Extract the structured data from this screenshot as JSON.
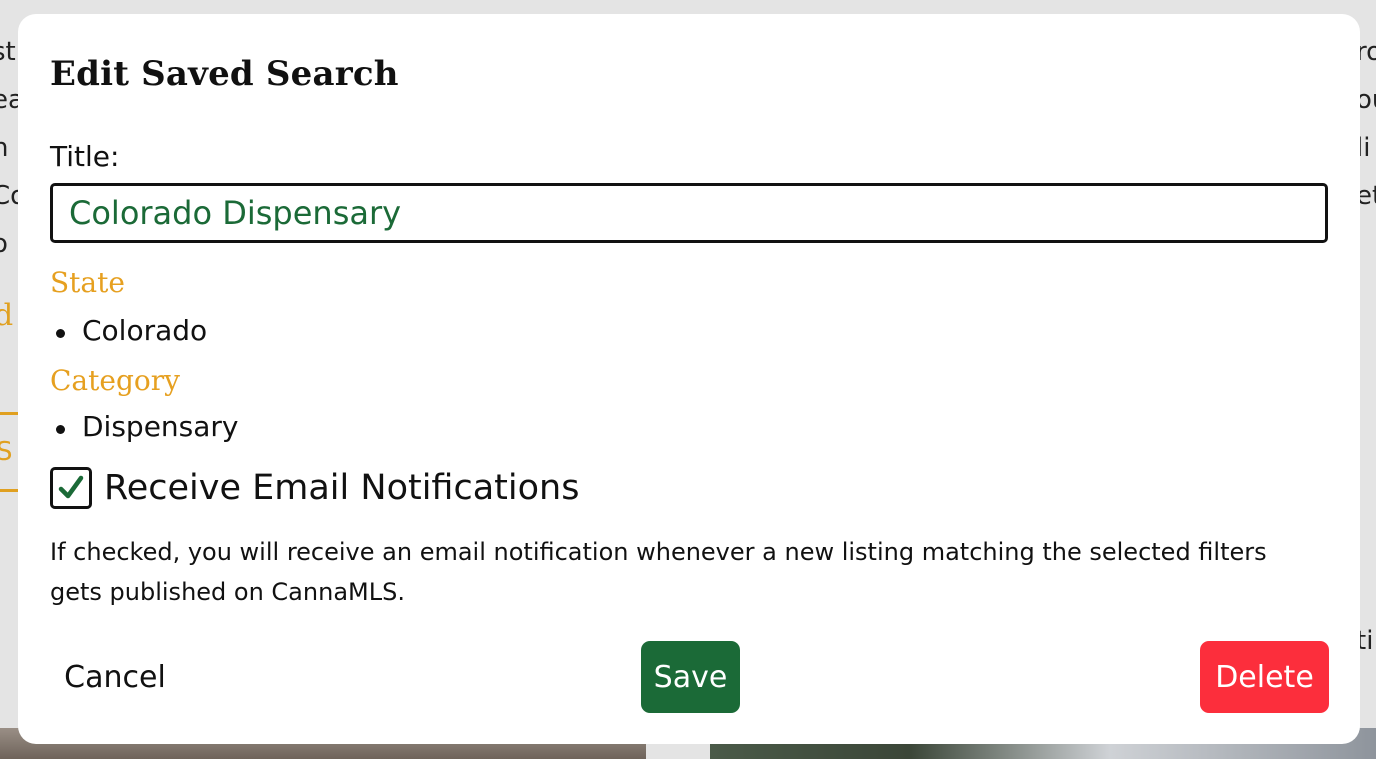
{
  "background": {
    "left_fragments": [
      "st",
      "ea",
      "n",
      "Co",
      "o"
    ],
    "left_accent": "d",
    "left_box_text": "S",
    "right_fragments": [
      "ro",
      "ou",
      "li",
      "et"
    ],
    "right_low": "ti"
  },
  "modal": {
    "title": "Edit Saved Search",
    "title_label": "Title:",
    "title_value": "Colorado Dispensary",
    "sections": [
      {
        "heading": "State",
        "items": [
          "Colorado"
        ]
      },
      {
        "heading": "Category",
        "items": [
          "Dispensary"
        ]
      }
    ],
    "notifications": {
      "checked": true,
      "label": "Receive Email Notifications",
      "help": "If checked, you will receive an email notification whenever a new listing matching the selected filters gets published on CannaMLS."
    },
    "buttons": {
      "cancel": "Cancel",
      "save": "Save",
      "delete": "Delete"
    }
  },
  "colors": {
    "accent_orange": "#e6a020",
    "brand_green": "#1b6a37",
    "danger_red": "#fc2e3c"
  },
  "icons": {
    "checkbox": "check-icon"
  }
}
